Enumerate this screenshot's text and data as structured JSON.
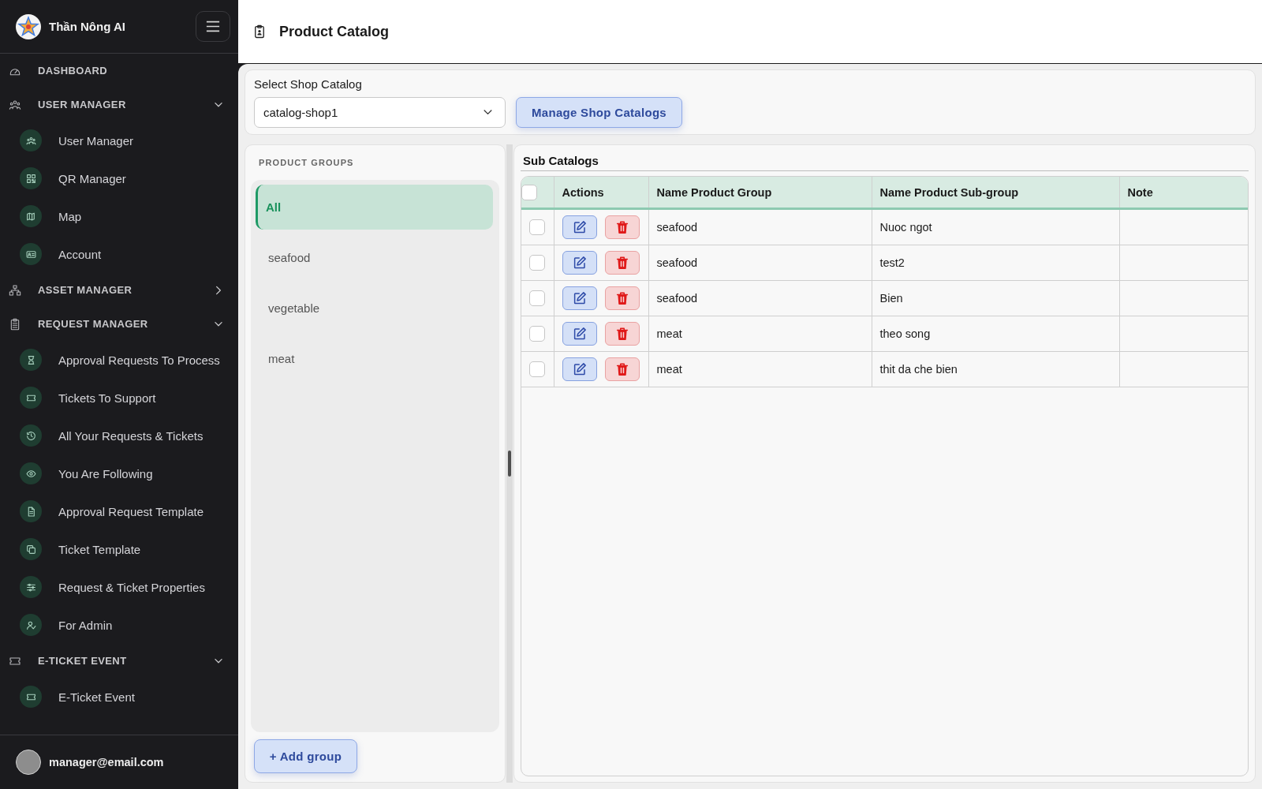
{
  "sidebar": {
    "brand": "Thần Nông AI",
    "nav": [
      {
        "kind": "link",
        "label": "DASHBOARD"
      },
      {
        "kind": "group",
        "label": "USER MANAGER",
        "expanded": true,
        "children": [
          {
            "label": "User Manager"
          },
          {
            "label": "QR Manager"
          },
          {
            "label": "Map"
          },
          {
            "label": "Account"
          }
        ]
      },
      {
        "kind": "group",
        "label": "ASSET MANAGER",
        "expanded": false
      },
      {
        "kind": "group",
        "label": "REQUEST MANAGER",
        "expanded": true,
        "children": [
          {
            "label": "Approval Requests To Process"
          },
          {
            "label": "Tickets To Support"
          },
          {
            "label": "All Your Requests & Tickets"
          },
          {
            "label": "You Are Following"
          },
          {
            "label": "Approval Request Template"
          },
          {
            "label": "Ticket Template"
          },
          {
            "label": "Request & Ticket Properties"
          },
          {
            "label": "For Admin"
          }
        ]
      },
      {
        "kind": "group",
        "label": "E-TICKET EVENT",
        "expanded": true,
        "children": [
          {
            "label": "E-Ticket Event"
          }
        ]
      }
    ],
    "user": {
      "email": "manager@email.com"
    }
  },
  "header": {
    "title": "Product Catalog"
  },
  "shop_catalog": {
    "label": "Select Shop Catalog",
    "value": "catalog-shop1",
    "button": "Manage Shop Catalogs"
  },
  "product_groups": {
    "title": "PRODUCT GROUPS",
    "items": [
      {
        "label": "All",
        "selected": true
      },
      {
        "label": "seafood",
        "selected": false
      },
      {
        "label": "vegetable",
        "selected": false
      },
      {
        "label": "meat",
        "selected": false
      }
    ],
    "add_button": "+ Add group"
  },
  "sub_catalogs": {
    "title": "Sub Catalogs",
    "select_all_checked": false,
    "columns": [
      "Actions",
      "Name Product Group",
      "Name Product Sub-group",
      "Note"
    ],
    "rows": [
      {
        "checked": false,
        "group": "seafood",
        "subgroup": "Nuoc ngot"
      },
      {
        "checked": false,
        "group": "seafood",
        "subgroup": "test2"
      },
      {
        "checked": false,
        "group": "seafood",
        "subgroup": "Bien"
      },
      {
        "checked": false,
        "group": "meat",
        "subgroup": "theo song"
      },
      {
        "checked": false,
        "group": "meat",
        "subgroup": "thit da che bien"
      }
    ]
  }
}
